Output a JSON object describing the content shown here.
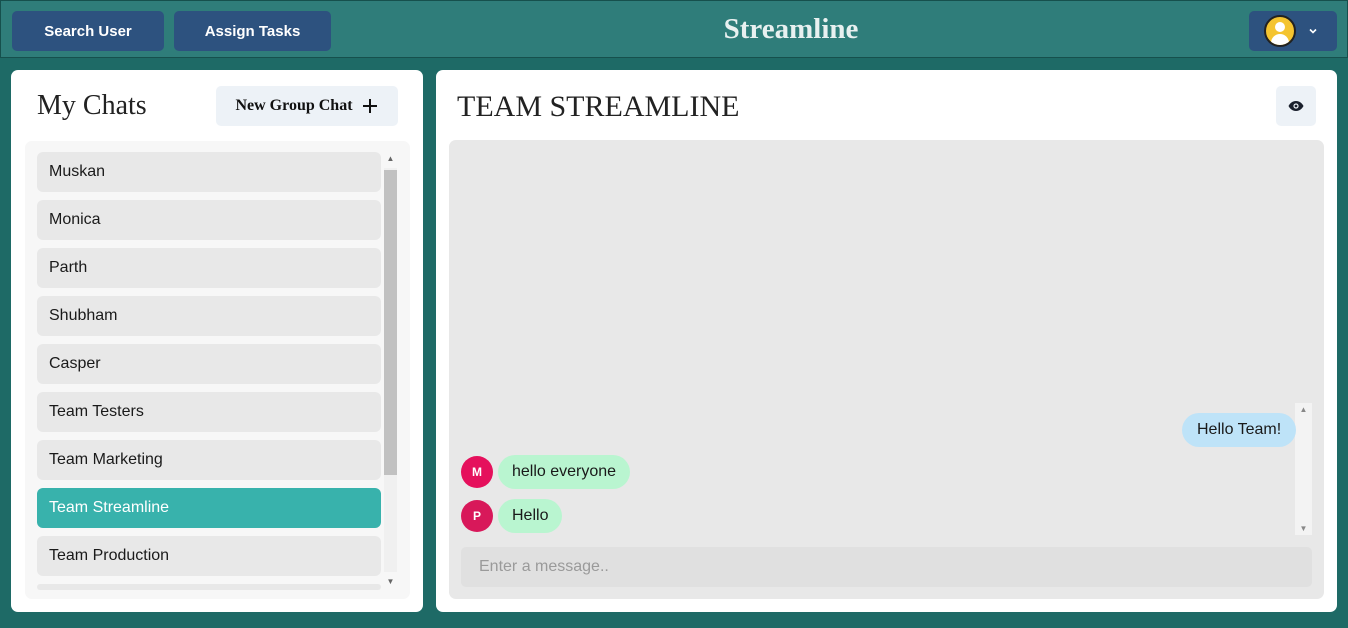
{
  "header": {
    "search_user_label": "Search User",
    "assign_tasks_label": "Assign Tasks",
    "app_title": "Streamline",
    "profile_icon": "user-avatar-icon",
    "dropdown_icon": "chevron-down-icon"
  },
  "sidebar": {
    "title": "My Chats",
    "new_group_label": "New Group Chat",
    "new_group_icon": "plus-icon",
    "chats": [
      {
        "label": "Muskan"
      },
      {
        "label": "Monica"
      },
      {
        "label": "Parth"
      },
      {
        "label": "Shubham"
      },
      {
        "label": "Casper"
      },
      {
        "label": "Team Testers"
      },
      {
        "label": "Team Marketing"
      },
      {
        "label": "Team Streamline"
      },
      {
        "label": "Team Production"
      }
    ],
    "active_chat": "Team Streamline"
  },
  "chat": {
    "title": "TEAM STREAMLINE",
    "view_icon": "eye-icon",
    "messages": [
      {
        "text": "Hello Team!",
        "own": true
      },
      {
        "sender_initial": "M",
        "text": "hello everyone",
        "avatar_color": "#e5105c"
      },
      {
        "sender_initial": "P",
        "text": "Hello",
        "avatar_color": "#d8185a"
      }
    ],
    "input_placeholder": "Enter a message.."
  },
  "colors": {
    "header_bg": "#2f7d7a",
    "button_bg": "#2d527f",
    "active_chat": "#38b2ac",
    "own_bubble": "#bee3f8",
    "other_bubble": "#b9f5d0"
  }
}
